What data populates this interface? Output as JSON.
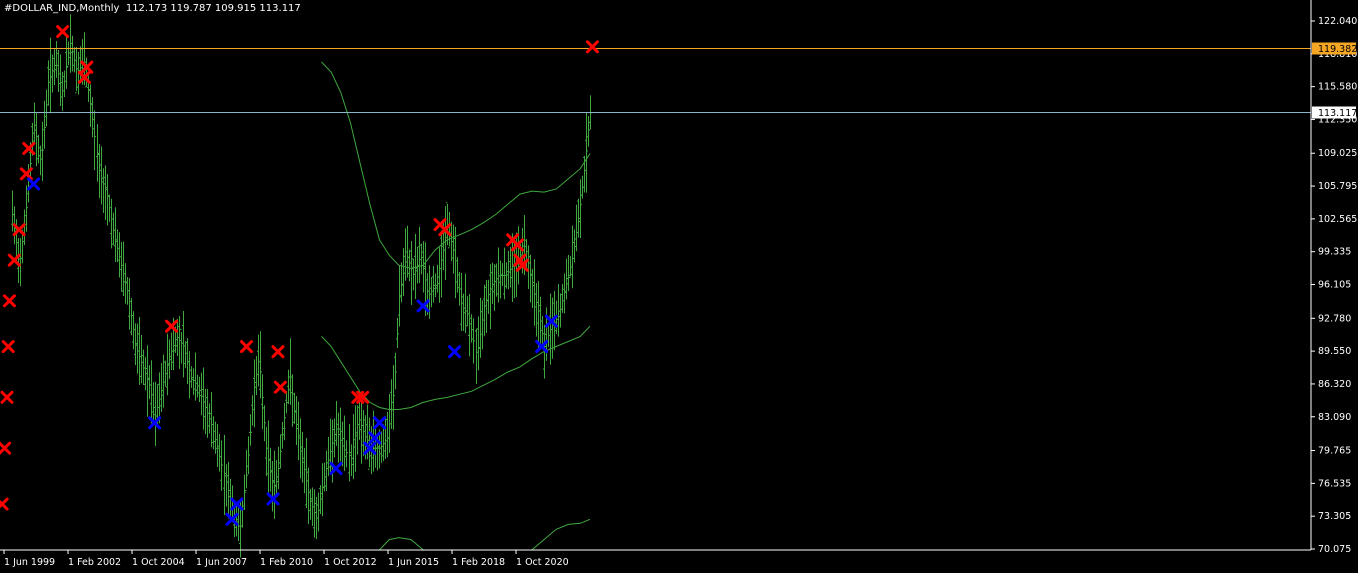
{
  "header": {
    "symbol_text": "#DOLLAR_IND,Monthly",
    "ohlc_text": "112.173 119.787 109.915 113.117"
  },
  "chart_data": {
    "type": "candlestick-ohlc-bars",
    "symbol": "#DOLLAR_IND",
    "timeframe": "Monthly",
    "ohlc": {
      "open": 112.173,
      "high": 119.787,
      "low": 109.915,
      "close": 113.117
    },
    "ylim": [
      70.075,
      122.04
    ],
    "y_ticks": [
      "122.040",
      "118.810",
      "115.580",
      "112.350",
      "109.025",
      "105.795",
      "102.565",
      "99.335",
      "96.105",
      "92.780",
      "89.550",
      "86.320",
      "83.090",
      "79.765",
      "76.535",
      "73.305",
      "70.075"
    ],
    "x_ticks": [
      "1 Jun 1999",
      "1 Feb 2002",
      "1 Oct 2004",
      "1 Jun 2007",
      "1 Feb 2010",
      "1 Oct 2012",
      "1 Jun 2015",
      "1 Feb 2018",
      "1 Oct 2020"
    ],
    "horizontal_lines": [
      {
        "label": "119.382",
        "value": 119.382,
        "color": "#f5a623",
        "label_bg": "#f5a623",
        "label_fg": "#000000"
      },
      {
        "label": "113.117",
        "value": 113.117,
        "color": "#8ab4c8",
        "label_bg": "#ffffff",
        "label_fg": "#000000"
      }
    ],
    "bar_color": "#3fa83f",
    "envelope_color": "#3fa83f",
    "sell_marker_color": "#ff0000",
    "buy_marker_color": "#0000ff",
    "grid": false,
    "price_path": [
      [
        1999.0,
        103
      ],
      [
        1999.3,
        98
      ],
      [
        1999.6,
        104
      ],
      [
        1999.9,
        112
      ],
      [
        2000.2,
        108
      ],
      [
        2000.5,
        116
      ],
      [
        2000.8,
        118
      ],
      [
        2001.1,
        115
      ],
      [
        2001.4,
        120
      ],
      [
        2001.7,
        117
      ],
      [
        2002.0,
        118
      ],
      [
        2002.3,
        113
      ],
      [
        2002.6,
        107
      ],
      [
        2002.9,
        105
      ],
      [
        2003.2,
        101
      ],
      [
        2003.5,
        98
      ],
      [
        2003.8,
        95
      ],
      [
        2004.1,
        90
      ],
      [
        2004.4,
        88
      ],
      [
        2004.7,
        86
      ],
      [
        2004.9,
        83
      ],
      [
        2005.2,
        86
      ],
      [
        2005.5,
        89
      ],
      [
        2005.8,
        91
      ],
      [
        2006.1,
        90
      ],
      [
        2006.4,
        87
      ],
      [
        2006.7,
        86
      ],
      [
        2007.0,
        84
      ],
      [
        2007.3,
        82
      ],
      [
        2007.6,
        79
      ],
      [
        2007.9,
        76
      ],
      [
        2008.2,
        73
      ],
      [
        2008.4,
        72
      ],
      [
        2008.7,
        78
      ],
      [
        2009.0,
        86
      ],
      [
        2009.2,
        89
      ],
      [
        2009.5,
        80
      ],
      [
        2009.8,
        76
      ],
      [
        2010.0,
        78
      ],
      [
        2010.3,
        84
      ],
      [
        2010.5,
        87
      ],
      [
        2010.7,
        83
      ],
      [
        2011.0,
        79
      ],
      [
        2011.3,
        75
      ],
      [
        2011.6,
        73
      ],
      [
        2011.9,
        77
      ],
      [
        2012.1,
        79
      ],
      [
        2012.4,
        82
      ],
      [
        2012.7,
        80
      ],
      [
        2013.0,
        79
      ],
      [
        2013.3,
        83
      ],
      [
        2013.6,
        81
      ],
      [
        2013.9,
        80
      ],
      [
        2014.2,
        80
      ],
      [
        2014.5,
        81
      ],
      [
        2014.8,
        86
      ],
      [
        2015.0,
        95
      ],
      [
        2015.3,
        99
      ],
      [
        2015.6,
        97
      ],
      [
        2015.9,
        99
      ],
      [
        2016.2,
        95
      ],
      [
        2016.5,
        96
      ],
      [
        2016.8,
        99
      ],
      [
        2017.0,
        102
      ],
      [
        2017.3,
        99
      ],
      [
        2017.6,
        94
      ],
      [
        2017.9,
        93
      ],
      [
        2018.2,
        89
      ],
      [
        2018.5,
        94
      ],
      [
        2018.8,
        96
      ],
      [
        2019.1,
        97
      ],
      [
        2019.4,
        97
      ],
      [
        2019.7,
        98
      ],
      [
        2020.0,
        99
      ],
      [
        2020.2,
        100
      ],
      [
        2020.5,
        96
      ],
      [
        2020.8,
        93
      ],
      [
        2021.0,
        90
      ],
      [
        2021.3,
        92
      ],
      [
        2021.6,
        93
      ],
      [
        2021.9,
        96
      ],
      [
        2022.2,
        99
      ],
      [
        2022.5,
        104
      ],
      [
        2022.7,
        108
      ],
      [
        2022.9,
        113
      ]
    ],
    "envelopes": [
      {
        "name": "upper-band",
        "points": [
          [
            2011.8,
            118.0
          ],
          [
            2012.2,
            117.0
          ],
          [
            2012.6,
            115.0
          ],
          [
            2013.0,
            112.0
          ],
          [
            2013.4,
            108.0
          ],
          [
            2013.8,
            104.0
          ],
          [
            2014.2,
            100.5
          ],
          [
            2014.6,
            99.0
          ],
          [
            2015.0,
            98.0
          ],
          [
            2015.5,
            97.7
          ],
          [
            2016.0,
            98.0
          ],
          [
            2016.5,
            99.5
          ],
          [
            2017.0,
            100.5
          ],
          [
            2017.5,
            101.0
          ],
          [
            2018.0,
            101.5
          ],
          [
            2018.5,
            102.2
          ],
          [
            2019.0,
            103.0
          ],
          [
            2019.5,
            104.0
          ],
          [
            2020.0,
            105.0
          ],
          [
            2020.5,
            105.3
          ],
          [
            2021.0,
            105.2
          ],
          [
            2021.5,
            105.5
          ],
          [
            2022.0,
            106.5
          ],
          [
            2022.5,
            107.5
          ],
          [
            2022.9,
            109.0
          ]
        ]
      },
      {
        "name": "lower-band",
        "points": [
          [
            2011.8,
            91.0
          ],
          [
            2012.2,
            90.0
          ],
          [
            2012.6,
            88.5
          ],
          [
            2013.0,
            87.0
          ],
          [
            2013.4,
            85.5
          ],
          [
            2013.8,
            84.5
          ],
          [
            2014.2,
            84.0
          ],
          [
            2014.6,
            83.8
          ],
          [
            2015.0,
            83.8
          ],
          [
            2015.5,
            84.0
          ],
          [
            2016.0,
            84.5
          ],
          [
            2016.5,
            84.8
          ],
          [
            2017.0,
            85.0
          ],
          [
            2017.5,
            85.3
          ],
          [
            2018.0,
            85.6
          ],
          [
            2018.5,
            86.2
          ],
          [
            2019.0,
            86.8
          ],
          [
            2019.5,
            87.5
          ],
          [
            2020.0,
            88.0
          ],
          [
            2020.5,
            88.8
          ],
          [
            2021.0,
            89.5
          ],
          [
            2021.5,
            90.0
          ],
          [
            2022.0,
            90.5
          ],
          [
            2022.5,
            91.0
          ],
          [
            2022.9,
            92.0
          ]
        ]
      },
      {
        "name": "lowest-band",
        "points": [
          [
            2014.2,
            70.0
          ],
          [
            2014.6,
            71.0
          ],
          [
            2015.0,
            71.2
          ],
          [
            2015.5,
            71.0
          ],
          [
            2016.0,
            70.0
          ]
        ]
      },
      {
        "name": "lowest-band-2",
        "points": [
          [
            2020.5,
            70.0
          ],
          [
            2021.0,
            71.0
          ],
          [
            2021.5,
            72.0
          ],
          [
            2022.0,
            72.5
          ],
          [
            2022.5,
            72.6
          ],
          [
            2022.9,
            73.0
          ]
        ]
      }
    ],
    "sell_markers": [
      [
        1998.6,
        74.5
      ],
      [
        1998.7,
        80.0
      ],
      [
        1998.8,
        85.0
      ],
      [
        1998.85,
        90.0
      ],
      [
        1998.9,
        94.5
      ],
      [
        1999.1,
        98.5
      ],
      [
        1999.3,
        101.5
      ],
      [
        1999.6,
        107.0
      ],
      [
        1999.7,
        109.5
      ],
      [
        2001.1,
        121.0
      ],
      [
        2002.0,
        116.5
      ],
      [
        2002.1,
        117.5
      ],
      [
        2005.6,
        92.0
      ],
      [
        2008.7,
        90.0
      ],
      [
        2010.0,
        89.5
      ],
      [
        2010.1,
        86.0
      ],
      [
        2013.3,
        85.0
      ],
      [
        2013.5,
        85.0
      ],
      [
        2016.7,
        102.0
      ],
      [
        2016.9,
        101.5
      ],
      [
        2019.7,
        100.5
      ],
      [
        2019.9,
        100.0
      ],
      [
        2020.0,
        98.5
      ],
      [
        2020.1,
        98.0
      ],
      [
        2023.0,
        119.5
      ]
    ],
    "buy_markers": [
      [
        1999.9,
        106.0
      ],
      [
        2004.9,
        82.5
      ],
      [
        2008.1,
        73.0
      ],
      [
        2008.3,
        74.5
      ],
      [
        2009.8,
        75.0
      ],
      [
        2012.4,
        78.0
      ],
      [
        2013.8,
        80.0
      ],
      [
        2014.0,
        81.0
      ],
      [
        2014.2,
        82.5
      ],
      [
        2016.0,
        94.0
      ],
      [
        2017.3,
        89.5
      ],
      [
        2020.9,
        90.0
      ],
      [
        2021.3,
        92.5
      ]
    ]
  }
}
